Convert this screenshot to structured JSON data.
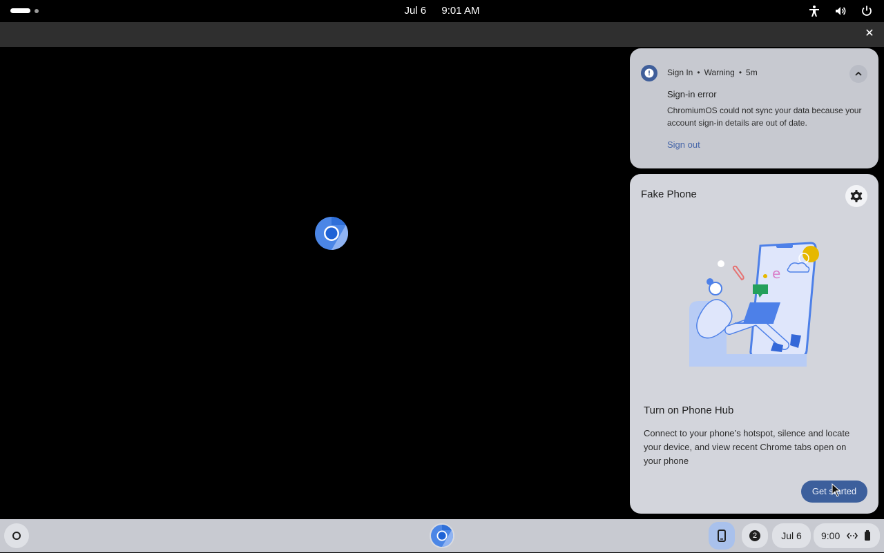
{
  "top_bar": {
    "date": "Jul 6",
    "time": "9:01 AM"
  },
  "icons": {
    "accessibility": "accessibility-icon",
    "volume": "volume-icon",
    "power": "power-icon",
    "close": "close-icon",
    "chrome": "chrome-icon",
    "settings": "gear-icon",
    "phone": "phone-icon",
    "network": "network-icon",
    "battery": "battery-icon"
  },
  "notification": {
    "source": "Sign In",
    "severity": "Warning",
    "age": "5m",
    "title": "Sign-in error",
    "body": "ChromiumOS could not sync your data because your account sign-in details are out of date.",
    "action": "Sign out"
  },
  "phone_hub": {
    "device_name": "Fake Phone",
    "title": "Turn on Phone Hub",
    "description": "Connect to your phone’s hotspot, silence and locate your device, and view recent Chrome tabs open on your phone",
    "button": "Get started"
  },
  "shelf": {
    "notification_count": "2",
    "date": "Jul 6",
    "time": "9:00"
  },
  "colors": {
    "accent": "#3c5f9c",
    "link": "#4565a8",
    "card": "#d3d5dc",
    "shelf": "#c8cad1"
  }
}
